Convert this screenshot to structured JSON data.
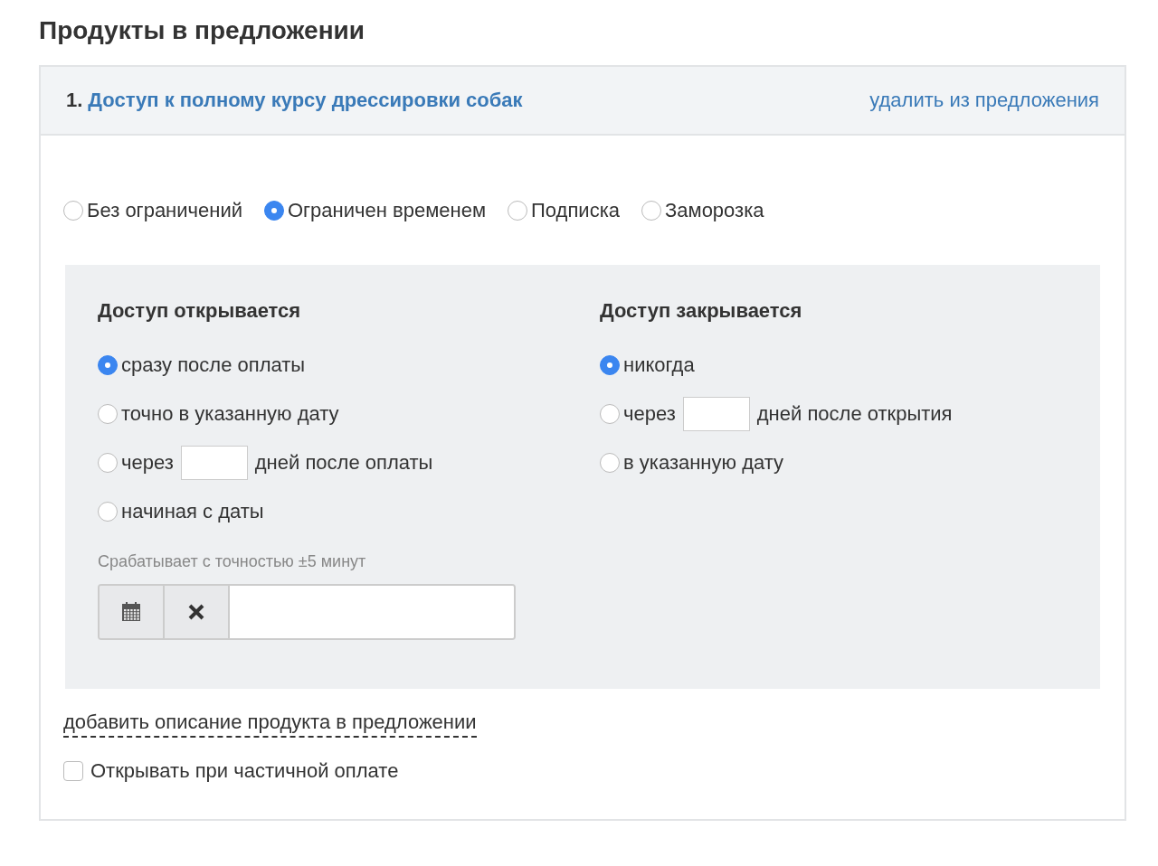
{
  "title": "Продукты в предложении",
  "product": {
    "number": "1.",
    "name": "Доступ к полному курсу дрессировки собак",
    "remove_link": "удалить из предложения"
  },
  "access_types": [
    {
      "label": "Без ограничений",
      "selected": false
    },
    {
      "label": "Ограничен временем",
      "selected": true
    },
    {
      "label": "Подписка",
      "selected": false
    },
    {
      "label": "Заморозка",
      "selected": false
    }
  ],
  "columns": [
    {
      "heading": "Доступ открывается",
      "options": [
        {
          "kind": "plain",
          "label": "сразу после оплаты",
          "selected": true
        },
        {
          "kind": "plain",
          "label": "точно в указанную дату",
          "selected": false
        },
        {
          "kind": "days",
          "before": "через",
          "after": "дней после оплаты",
          "selected": false
        },
        {
          "kind": "plain",
          "label": "начиная с даты",
          "selected": false
        }
      ],
      "hint": "Срабатывает с точностью ±5 минут",
      "date_field": true
    },
    {
      "heading": "Доступ закрывается",
      "options": [
        {
          "kind": "plain",
          "label": "никогда",
          "selected": true
        },
        {
          "kind": "days",
          "before": "через",
          "after": "дней после открытия",
          "selected": false
        },
        {
          "kind": "plain",
          "label": "в указанную дату",
          "selected": false
        }
      ]
    }
  ],
  "description_link": "добавить описание продукта в предложении",
  "partial_payment": {
    "label": "Открывать при частичной оплате",
    "checked": false
  }
}
